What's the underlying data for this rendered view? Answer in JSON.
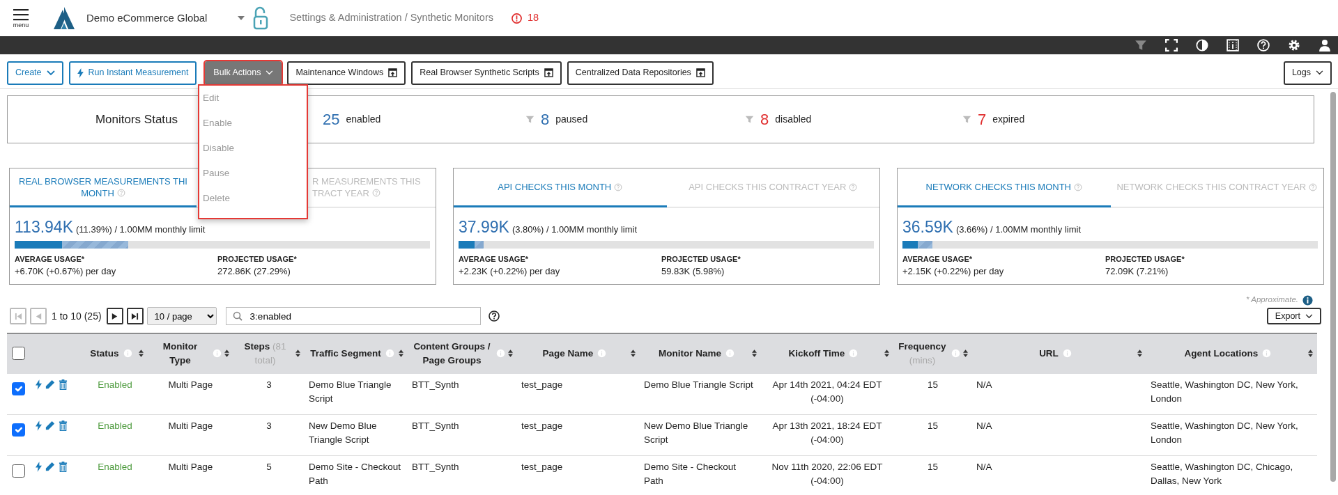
{
  "header": {
    "menu_label": "menu",
    "account": "Demo eCommerce Global",
    "breadcrumb": "Settings & Administration / Synthetic Monitors",
    "alert_count": "18"
  },
  "toolbar": {
    "buttons": [
      {
        "label": "Create",
        "kind": "create"
      },
      {
        "label": "Run Instant Measurement",
        "kind": "run"
      },
      {
        "label": "Bulk Actions",
        "kind": "bulk",
        "expanded": true
      },
      {
        "label": "Maintenance Windows",
        "kind": "popout"
      },
      {
        "label": "Real Browser Synthetic Scripts",
        "kind": "popout"
      },
      {
        "label": "Centralized Data Repositories",
        "kind": "popout"
      }
    ],
    "logs": "Logs"
  },
  "bulk_menu": [
    {
      "label": "Edit",
      "disabled": true
    },
    {
      "label": "Enable",
      "disabled": true
    },
    {
      "label": "Disable",
      "disabled": true
    },
    {
      "label": "Pause",
      "disabled": true
    },
    {
      "label": "Delete",
      "disabled": true
    }
  ],
  "monitors_status": {
    "title": "Monitors Status",
    "counts": [
      {
        "value": "25",
        "label": "enabled",
        "color": "#2f6fb0",
        "filter_icon": false
      },
      {
        "value": "8",
        "label": "paused",
        "color": "#2f6fb0",
        "filter_icon": true
      },
      {
        "value": "8",
        "label": "disabled",
        "color": "#e02d2d",
        "filter_icon": true
      },
      {
        "value": "7",
        "label": "expired",
        "color": "#e02d2d",
        "filter_icon": true
      }
    ]
  },
  "usage_cards": [
    {
      "tabs": [
        {
          "lines": [
            "REAL BROWSER MEASUREMENTS THI",
            "MONTH"
          ],
          "selected": true
        },
        {
          "lines": [
            "R MEASUREMENTS THIS",
            "TRACT YEAR"
          ],
          "selected": false
        }
      ],
      "value": "113.94K",
      "percent": "(11.39%)",
      "limit": "/ 1.00MM monthly limit",
      "segments": [
        {
          "kind": "actual",
          "level": 0.1139
        },
        {
          "kind": "projected",
          "level": 0.2729
        }
      ],
      "average_label": "AVERAGE USAGE*",
      "average": "+6.70K (+0.67%) per day",
      "projected_label": "PROJECTED USAGE*",
      "projected": "272.86K (27.29%)"
    },
    {
      "tabs": [
        {
          "lines": [
            "API CHECKS THIS MONTH"
          ],
          "selected": true
        },
        {
          "lines": [
            "API CHECKS THIS CONTRACT YEAR"
          ],
          "selected": false
        }
      ],
      "value": "37.99K",
      "percent": "(3.80%)",
      "limit": "/ 1.00MM monthly limit",
      "segments": [
        {
          "kind": "actual",
          "level": 0.038
        },
        {
          "kind": "projected",
          "level": 0.0598
        }
      ],
      "average_label": "AVERAGE USAGE*",
      "average": "+2.23K (+0.22%) per day",
      "projected_label": "PROJECTED USAGE*",
      "projected": "59.83K (5.98%)"
    },
    {
      "tabs": [
        {
          "lines": [
            "NETWORK CHECKS THIS MONTH"
          ],
          "selected": true
        },
        {
          "lines": [
            "NETWORK CHECKS THIS CONTRACT YEAR"
          ],
          "selected": false
        }
      ],
      "value": "36.59K",
      "percent": "(3.66%)",
      "limit": "/ 1.00MM monthly limit",
      "segments": [
        {
          "kind": "actual",
          "level": 0.0366
        },
        {
          "kind": "projected",
          "level": 0.0721
        }
      ],
      "average_label": "AVERAGE USAGE*",
      "average": "+2.15K (+0.22%) per day",
      "projected_label": "PROJECTED USAGE*",
      "projected": "72.09K (7.21%)"
    }
  ],
  "approximate_note": "* Approximate.",
  "pagination": {
    "first_disabled": true,
    "prev_disabled": true,
    "range": "1 to 10 (25)",
    "next_disabled": false,
    "last_disabled": false,
    "page_size": "10 / page",
    "search": "3:enabled"
  },
  "export": "Export",
  "table": {
    "all_selected": false,
    "columns": [
      {
        "label": "Status",
        "info": true
      },
      {
        "label": "Monitor Type",
        "info": true
      },
      {
        "label": "Steps",
        "note": "(81 total)",
        "info": false
      },
      {
        "label": "Traffic Segment",
        "info": true
      },
      {
        "label": "Content Groups / Page Groups",
        "info": true
      },
      {
        "label": "Page Name",
        "info": true
      },
      {
        "label": "Monitor Name",
        "info": true
      },
      {
        "label": "Kickoff Time",
        "info": true
      },
      {
        "label": "Frequency",
        "note": "(mins)",
        "info": true
      },
      {
        "label": "URL",
        "info": true
      },
      {
        "label": "Agent Locations",
        "info": true
      }
    ],
    "rows": [
      {
        "selected": true,
        "cells": [
          "Enabled",
          "Multi Page",
          "3",
          "Demo Blue Triangle Script",
          "BTT_Synth",
          "test_page",
          "Demo Blue Triangle Script",
          "Apr 14th 2021, 04:24 EDT (-04:00)",
          "15",
          "N/A",
          "Seattle, Washington DC, New York, London"
        ]
      },
      {
        "selected": true,
        "cells": [
          "Enabled",
          "Multi Page",
          "3",
          "New Demo Blue Triangle Script",
          "BTT_Synth",
          "test_page",
          "New Demo Blue Triangle Script",
          "Apr 13th 2021, 18:24 EDT (-04:00)",
          "15",
          "N/A",
          "Seattle, Washington DC, New York, London"
        ]
      },
      {
        "selected": false,
        "cells": [
          "Enabled",
          "Multi Page",
          "5",
          "Demo Site - Checkout Path",
          "BTT_Synth",
          "test_page",
          "Demo Site - Checkout Path",
          "Nov 11th 2020, 22:06 EDT (-04:00)",
          "15",
          "N/A",
          "Seattle, Washington DC, Chicago, Dallas, New York"
        ]
      }
    ]
  }
}
